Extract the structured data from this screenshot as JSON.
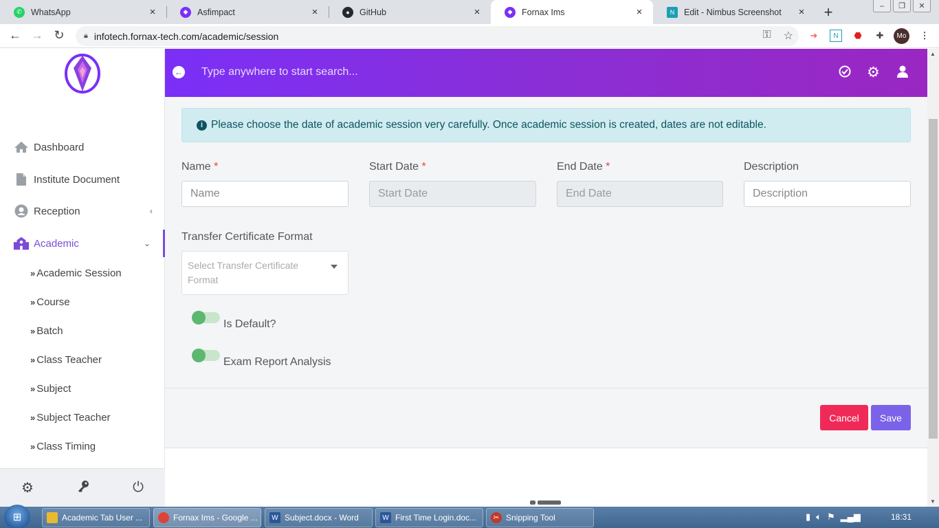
{
  "browser": {
    "tabs": [
      {
        "title": "WhatsApp",
        "color": "#25d366",
        "icon": "whatsapp-icon"
      },
      {
        "title": "Asfimpact",
        "color": "#7b2ff7",
        "icon": "asfimpact-icon"
      },
      {
        "title": "GitHub",
        "color": "#24292e",
        "icon": "github-icon"
      },
      {
        "title": "Fornax Ims",
        "color": "#7b2ff7",
        "icon": "fornax-icon"
      },
      {
        "title": "Edit - Nimbus Screenshot",
        "color": "#1aa0b4",
        "icon": "nimbus-icon"
      }
    ],
    "active_tab_index": 3,
    "url": "infotech.fornax-tech.com/academic/session",
    "profile_initials": "Mo"
  },
  "sidebar": {
    "menu": [
      {
        "label": "Dashboard",
        "icon": "home-icon"
      },
      {
        "label": "Institute Document",
        "icon": "document-icon"
      },
      {
        "label": "Reception",
        "icon": "user-circle-icon"
      },
      {
        "label": "Academic",
        "icon": "school-icon"
      }
    ],
    "submenu": [
      {
        "label": "Academic Session"
      },
      {
        "label": "Course"
      },
      {
        "label": "Batch"
      },
      {
        "label": "Class Teacher"
      },
      {
        "label": "Subject"
      },
      {
        "label": "Subject Teacher"
      },
      {
        "label": "Class Timing"
      }
    ]
  },
  "header": {
    "search_placeholder": "Type anywhere to start search..."
  },
  "form": {
    "alert": "Please choose the date of academic session very carefully. Once academic session is created, dates are not editable.",
    "required_mark": "*",
    "name_label": "Name",
    "name_placeholder": "Name",
    "start_label": "Start Date",
    "start_placeholder": "Start Date",
    "end_label": "End Date",
    "end_placeholder": "End Date",
    "desc_label": "Description",
    "desc_placeholder": "Description",
    "tc_label": "Transfer Certificate Format",
    "tc_placeholder": "Select Transfer Certificate Format",
    "is_default_label": "Is Default?",
    "exam_report_label": "Exam Report Analysis",
    "cancel": "Cancel",
    "save": "Save"
  },
  "taskbar": {
    "items": [
      {
        "label": "Academic Tab User ...",
        "icon": "folder-icon",
        "color": "#e8b931"
      },
      {
        "label": "Fornax Ims - Google ...",
        "icon": "chrome-icon",
        "color": "#db4437"
      },
      {
        "label": "Subject.docx - Word",
        "icon": "word-icon",
        "color": "#2b579a"
      },
      {
        "label": "First Time Login.doc...",
        "icon": "word-icon",
        "color": "#2b579a"
      },
      {
        "label": "Snipping Tool",
        "icon": "scissors-icon",
        "color": "#c0392b"
      }
    ],
    "clock": "18:31"
  },
  "colors": {
    "accent": "#7b2ff7",
    "cancel": "#f02a58",
    "save": "#7b62e8",
    "toggle": "#5cb870"
  }
}
